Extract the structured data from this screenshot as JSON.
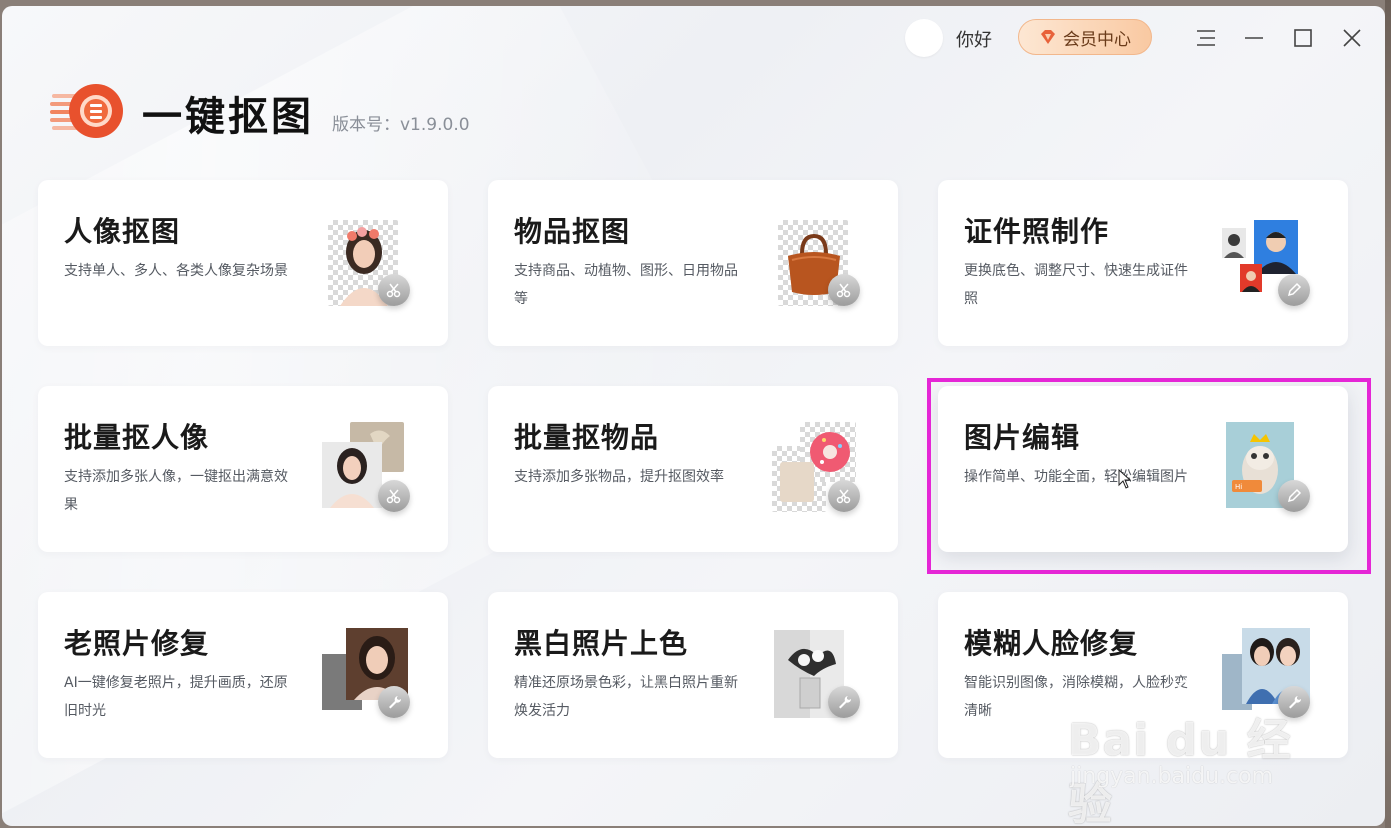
{
  "header": {
    "greeting": "你好",
    "vip_label": "会员中心"
  },
  "app": {
    "title": "一键抠图",
    "version": "版本号：v1.9.0.0"
  },
  "cards": [
    {
      "title": "人像抠图",
      "desc": "支持单人、多人、各类人像复杂场景",
      "icon": "scissors-icon"
    },
    {
      "title": "物品抠图",
      "desc": "支持商品、动植物、图形、日用物品等",
      "icon": "scissors-icon"
    },
    {
      "title": "证件照制作",
      "desc": "更换底色、调整尺寸、快速生成证件照",
      "icon": "pencil-icon"
    },
    {
      "title": "批量抠人像",
      "desc": "支持添加多张人像，一键抠出满意效果",
      "icon": "scissors-icon"
    },
    {
      "title": "批量抠物品",
      "desc": "支持添加多张物品，提升抠图效率",
      "icon": "scissors-icon"
    },
    {
      "title": "图片编辑",
      "desc": "操作简单、功能全面，轻松编辑图片",
      "icon": "pencil-icon"
    },
    {
      "title": "老照片修复",
      "desc": "AI一键修复老照片，提升画质，还原旧时光",
      "icon": "wrench-icon"
    },
    {
      "title": "黑白照片上色",
      "desc": "精准还原场景色彩，让黑白照片重新焕发活力",
      "icon": "wrench-icon"
    },
    {
      "title": "模糊人脸修复",
      "desc": "智能识别图像，消除模糊，人脸秒变清晰",
      "icon": "wrench-icon"
    }
  ],
  "watermark": {
    "main": "Bai du 经验",
    "sub": "jingyan.baidu.com"
  },
  "colors": {
    "accent": "#e8512d",
    "highlight": "#e526d6",
    "vip_bg": "#f9c9a2"
  }
}
